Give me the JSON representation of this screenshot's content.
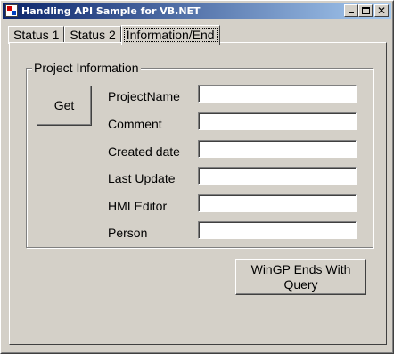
{
  "window": {
    "title": "Handling API Sample for VB.NET",
    "controls": {
      "minimize": "minimize-icon",
      "maximize": "maximize-icon",
      "close": "close-icon",
      "close_glyph": "✕"
    }
  },
  "tabs": [
    {
      "label": "Status 1"
    },
    {
      "label": "Status 2"
    },
    {
      "label": "Information/End",
      "active": true
    }
  ],
  "project_info": {
    "legend": "Project Information",
    "get_label": "Get",
    "fields": [
      {
        "label": "ProjectName",
        "value": ""
      },
      {
        "label": "Comment",
        "value": ""
      },
      {
        "label": "Created date",
        "value": ""
      },
      {
        "label": "Last Update",
        "value": ""
      },
      {
        "label": "HMI Editor",
        "value": ""
      },
      {
        "label": "Person",
        "value": ""
      }
    ]
  },
  "end_button": {
    "label": "WinGP Ends With Query"
  },
  "colors": {
    "face": "#d4d0c8",
    "titlebar_start": "#0a246a",
    "titlebar_end": "#a6caf0",
    "field_bg": "#ffffff"
  }
}
